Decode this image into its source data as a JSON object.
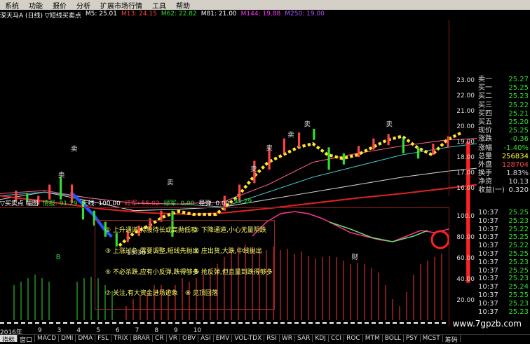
{
  "menu": [
    "系统",
    "功能",
    "报价",
    "分析",
    "扩展市场行情",
    "工具",
    "帮助"
  ],
  "top_info": {
    "title": "深天马A (日线) ▽短线买卖点",
    "ma": [
      {
        "label": "M5: 25.01",
        "color": "#ffffff"
      },
      {
        "label": "M13: 24.15",
        "color": "#ff4444"
      },
      {
        "label": "M62: 22.82",
        "color": "#33dd33"
      },
      {
        "label": "M81: 21.00",
        "color": "#ffffff"
      },
      {
        "label": "M144: 19.88",
        "color": "#ff33ff"
      },
      {
        "label": "M250: 19.00",
        "color": "#aa55ff"
      }
    ]
  },
  "price_axis": [
    "23.00",
    "22.00",
    "21.00",
    "20.00",
    "19.00",
    "18.00",
    "17.00",
    "16.00"
  ],
  "indicator_axis": [
    "100.0",
    "80.00",
    "60.00",
    "40.00",
    "20.00"
  ],
  "low_label": "15.38",
  "indicator_header": {
    "title": "▽买卖点 幅图",
    "vals": [
      {
        "label": "情报: 91.29",
        "color": "#33dd33"
      },
      {
        "label": "天线: 100.00",
        "color": "#ffffff"
      },
      {
        "label": "红军: 55.02",
        "color": "#ff4444"
      },
      {
        "label": "绿军: 0.00",
        "color": "#33dd33"
      },
      {
        "label": "导弹: 0.00",
        "color": "#ffffff"
      },
      {
        "label": "91.29",
        "color": "#33dd33"
      }
    ]
  },
  "notes": [
    "① 上升通道,持股待长或高抛低吸",
    "② 下降通道,小心无量阴跌",
    "③ 上涨过急,需要调整,短线先抛出",
    "④ 庄出货,大跌,中线抛出",
    "⑤ 不必杀跌,应有小反弹,跌得够多",
    "⑥ 抢反弹,但且量到跌得够多",
    "⑦ 关注,有大资金进场迹象",
    "⑧ 见顶回落"
  ],
  "quote_panel": [
    {
      "label": "卖一",
      "value": "25.27",
      "color": "#33dd33"
    },
    {
      "label": "买一",
      "value": "25.25",
      "color": "#33dd33"
    },
    {
      "label": "买二",
      "value": "25.23",
      "color": "#33dd33"
    },
    {
      "label": "买三",
      "value": "25.22",
      "color": "#33dd33"
    },
    {
      "label": "买四",
      "value": "25.21",
      "color": "#33dd33"
    },
    {
      "label": "买五",
      "value": "25.20",
      "color": "#33dd33"
    },
    {
      "label": "现价",
      "value": "25.25",
      "color": "#33dd33"
    },
    {
      "label": "涨跌",
      "value": "-0.36",
      "color": "#33dd33"
    },
    {
      "label": "涨幅",
      "value": "-1.40%",
      "color": "#33dd33"
    },
    {
      "label": "总量",
      "value": "256834",
      "color": "#ffff33"
    },
    {
      "label": "外盘",
      "value": "128704",
      "color": "#ff4444"
    },
    {
      "label": "换手",
      "value": "1.83%",
      "color": "#ffffff"
    },
    {
      "label": "净资",
      "value": "10.13",
      "color": "#ffffff"
    },
    {
      "label": "收益(一)",
      "value": "0.320",
      "color": "#ffffff"
    }
  ],
  "trades": [
    {
      "time": "10:37",
      "price": "25.25"
    },
    {
      "time": "10:37",
      "price": "25.23"
    },
    {
      "time": "10:37",
      "price": "25.22"
    },
    {
      "time": "10:37",
      "price": "25.25"
    },
    {
      "time": "10:37",
      "price": "25.22"
    },
    {
      "time": "10:37",
      "price": "25.25"
    },
    {
      "time": "10:37",
      "price": "25.23"
    },
    {
      "time": "10:37",
      "price": "25.25"
    },
    {
      "time": "10:37",
      "price": "25.23"
    },
    {
      "time": "10:37",
      "price": "25.24"
    },
    {
      "time": "10:37",
      "price": "25.25"
    },
    {
      "time": "10:37",
      "price": "25.23"
    },
    {
      "time": "10:37",
      "price": "25.23"
    }
  ],
  "dates": [
    "2016年",
    "9",
    "3",
    "4",
    "5",
    "6",
    "7",
    "8",
    "9",
    "10"
  ],
  "tabs": [
    "指标",
    "窗口",
    "MACD",
    "DMI",
    "DMA",
    "FSL",
    "TRIX",
    "BRAR",
    "CR",
    "VR",
    "OBV",
    "ASI",
    "EMV",
    "VOL-TDX",
    "RSI",
    "WR",
    "SAR",
    "KDJ",
    "CCI",
    "ROC",
    "MTM",
    "BOLL",
    "PSY",
    "MCST",
    "筹码"
  ],
  "watermark": "www.7gpzb.com",
  "markers": {
    "sell": "卖",
    "buy_a": "B",
    "finance": "财"
  }
}
